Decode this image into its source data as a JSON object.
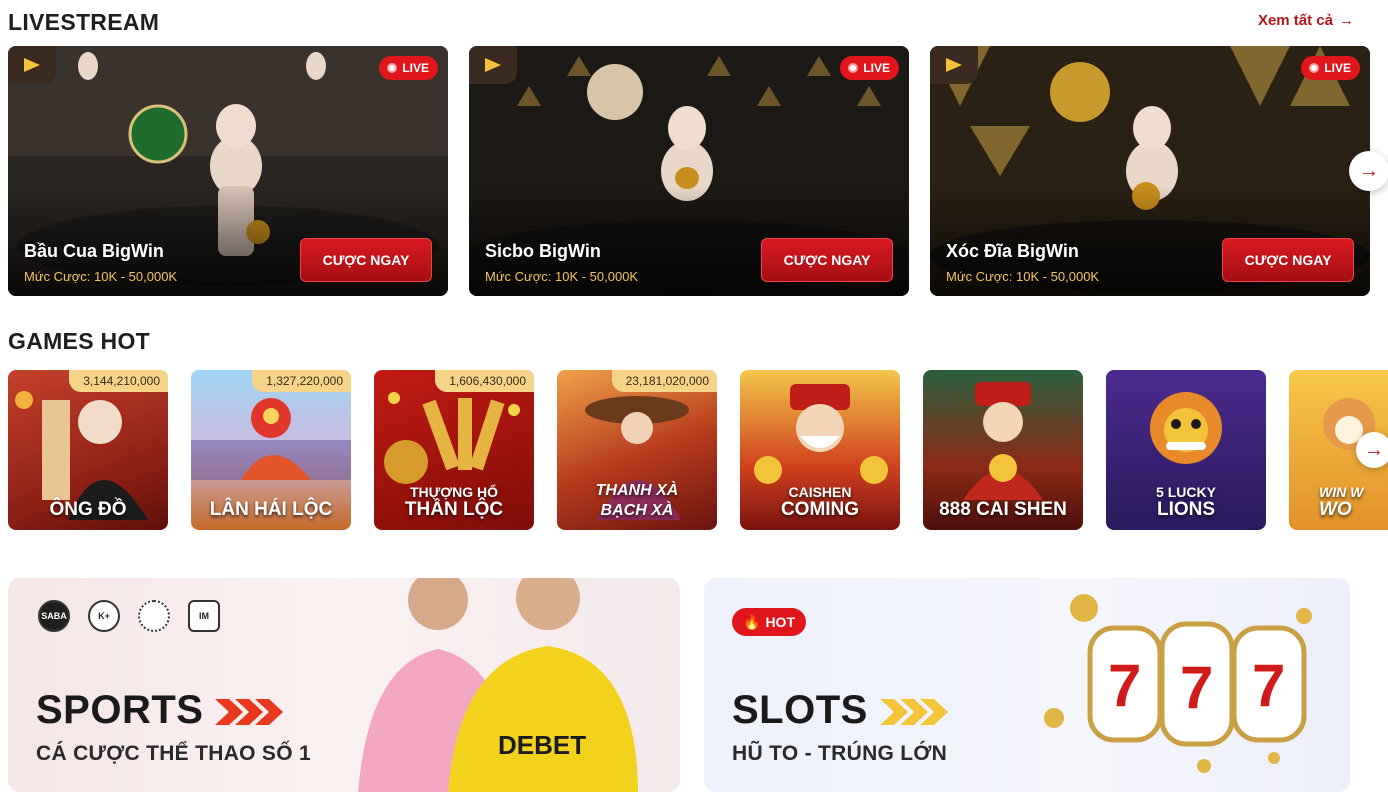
{
  "livestream": {
    "title": "LIVESTREAM",
    "see_all": "Xem tất cả",
    "live_label": "LIVE",
    "bet_button": "CƯỢC NGAY",
    "cards": [
      {
        "name": "Bầu Cua BigWin",
        "bet_range": "Mức Cược: 10K - 50,000K"
      },
      {
        "name": "Sicbo BigWin",
        "bet_range": "Mức Cược: 10K - 50,000K"
      },
      {
        "name": "Xóc Đĩa BigWin",
        "bet_range": "Mức Cược: 10K - 50,000K"
      }
    ]
  },
  "games_hot": {
    "title": "GAMES HOT",
    "tiles": [
      {
        "name": "ÔNG ĐỒ",
        "jackpot": "3,144,210,000"
      },
      {
        "name": "LÂN HÁI LỘC",
        "jackpot": "1,327,220,000"
      },
      {
        "name_top": "THƯỢNG HỔ",
        "name": "THẦN LỘC",
        "jackpot": "1,606,430,000"
      },
      {
        "name_top": "THANH XÀ",
        "name": "BẠCH XÀ",
        "jackpot": "23,181,020,000"
      },
      {
        "name_top": "CAISHEN",
        "name": "COMING"
      },
      {
        "name": "888 CAI SHEN"
      },
      {
        "name_top": "5 LUCKY",
        "name": "LIONS"
      },
      {
        "name_top": "WIN W",
        "name": "WO"
      }
    ]
  },
  "banners": {
    "sports": {
      "title": "SPORTS",
      "subtitle": "CÁ CƯỢC THỂ THAO SỐ 1",
      "providers": [
        "SABA",
        "K+",
        "",
        "IM"
      ],
      "jersey_text": "DEBET"
    },
    "slots": {
      "badge": "HOT",
      "title": "SLOTS",
      "subtitle": "HŨ TO - TRÚNG LỚN",
      "reel_symbol": "7"
    }
  },
  "colors": {
    "accent": "#c3141b",
    "jackpot": "#f5d48a",
    "bet_range": "#f3c65a"
  }
}
